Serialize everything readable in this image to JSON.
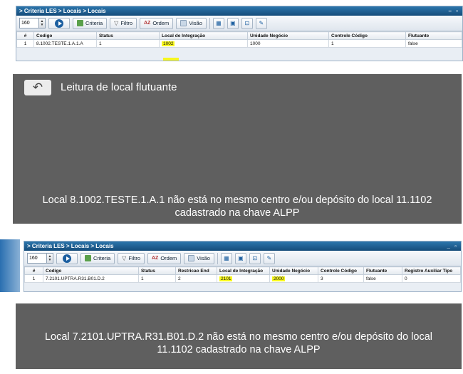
{
  "panel1": {
    "breadcrumb": "> Criteria LES > Locais > Locais",
    "window_controls": "– ▫",
    "page_size": "160",
    "buttons": {
      "criteria": "Criteria",
      "filtro": "Filtro",
      "ordem": "Ordem",
      "visao": "Visão"
    },
    "columns": [
      "#",
      "Codigo",
      "Status",
      "Local de Integração",
      "Unidade Negócio",
      "Controle Código",
      "Flutuante"
    ],
    "row": {
      "num": "1",
      "codigo": "8.1002.TESTE.1.A.1.A",
      "status": "1",
      "local_integracao": "1002",
      "unidade_negocio": "1000",
      "controle_codigo": "1",
      "flutuante": "false"
    }
  },
  "message1": {
    "back_icon": "back-arrow-icon",
    "heading": "Leitura de local flutuante",
    "line1": "Local 8.1002.TESTE.1.A.1 não está no mesmo centro e/ou depósito do local 11.1102",
    "line2": "cadastrado na chave ALPP"
  },
  "panel2": {
    "breadcrumb": "> Criteria LES > Locais > Locais",
    "window_controls": "_ ▫",
    "page_size": "160",
    "buttons": {
      "criteria": "Criteria",
      "filtro": "Filtro",
      "ordem": "Ordem",
      "visao": "Visão"
    },
    "columns": [
      "#",
      "Codigo",
      "Status",
      "Restricao End",
      "Local de Integração",
      "Unidade Negócio",
      "Controle Código",
      "Flutuante",
      "Registro Auxiliar Tipo"
    ],
    "row": {
      "num": "1",
      "codigo": "7.2101.UPTRA.R31.B01.D.2",
      "status": "1",
      "restricao_end": "2",
      "local_integracao": "2101",
      "unidade_negocio": "2000",
      "controle_codigo": "3",
      "flutuante": "false",
      "registro_auxiliar_tipo": "0"
    }
  },
  "message2": {
    "line1": "Local 7.2101.UPTRA.R31.B01.D.2 não está no mesmo centro e/ou depósito do local",
    "line2": "11.1102 cadastrado na chave ALPP"
  },
  "colors": {
    "title_bar": "#1f5f93",
    "message_bg": "#5f5f5f",
    "highlight": "#f7f71e"
  }
}
